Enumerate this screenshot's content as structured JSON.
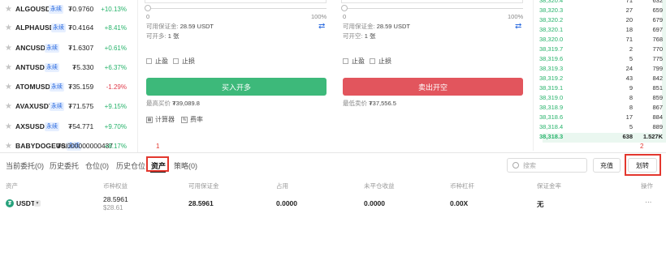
{
  "market": {
    "perp_tag": "永续",
    "rows": [
      {
        "symbol": "ALGOUSDT",
        "price": "₮0.9760",
        "change": "+10.13%",
        "dir": "up"
      },
      {
        "symbol": "ALPHAUSDT",
        "price": "₮0.4164",
        "change": "+8.41%",
        "dir": "up"
      },
      {
        "symbol": "ANCUSDT",
        "price": "₮1.6307",
        "change": "+0.61%",
        "dir": "up"
      },
      {
        "symbol": "ANTUSDT",
        "price": "₮5.330",
        "change": "+6.37%",
        "dir": "up"
      },
      {
        "symbol": "ATOMUSDT",
        "price": "₮35.159",
        "change": "-1.29%",
        "dir": "down"
      },
      {
        "symbol": "AVAXUSDT",
        "price": "₮71.575",
        "change": "+9.15%",
        "dir": "up"
      },
      {
        "symbol": "AXSUSDT",
        "price": "₮54.771",
        "change": "+9.70%",
        "dir": "up"
      },
      {
        "symbol": "BABYDOGEUSDT",
        "price": "₮0.000000000437",
        "change": "+8.17%",
        "dir": "up"
      }
    ]
  },
  "order_form": {
    "buy": {
      "slider_min": "0",
      "slider_max": "100%",
      "margin_label": "可用保证金:",
      "margin_value": "28.59 USDT",
      "open_label": "可开多:",
      "open_value": "1 张",
      "take_profit": "止盈",
      "stop_loss": "止损",
      "button": "买入开多",
      "price_label": "最高买价",
      "price_value": "₮39,089.8",
      "calculator": "计算器",
      "fee": "费率"
    },
    "sell": {
      "slider_min": "0",
      "slider_max": "100%",
      "margin_label": "可用保证金:",
      "margin_value": "28.59 USDT",
      "open_label": "可开空:",
      "open_value": "1 张",
      "take_profit": "止盈",
      "stop_loss": "止损",
      "button": "卖出开空",
      "price_label": "最低卖价",
      "price_value": "₮37,556.5"
    }
  },
  "order_book": {
    "rows": [
      {
        "price": "38,320.4",
        "qty": "71",
        "total": "632",
        "depth": 0.03
      },
      {
        "price": "38,320.3",
        "qty": "27",
        "total": "659",
        "depth": 0.03
      },
      {
        "price": "38,320.2",
        "qty": "20",
        "total": "679",
        "depth": 0.03
      },
      {
        "price": "38,320.1",
        "qty": "18",
        "total": "697",
        "depth": 0.03
      },
      {
        "price": "38,320.0",
        "qty": "71",
        "total": "768",
        "depth": 0.03
      },
      {
        "price": "38,319.7",
        "qty": "2",
        "total": "770",
        "depth": 0.03
      },
      {
        "price": "38,319.6",
        "qty": "5",
        "total": "775",
        "depth": 0.03
      },
      {
        "price": "38,319.3",
        "qty": "24",
        "total": "799",
        "depth": 0.03
      },
      {
        "price": "38,319.2",
        "qty": "43",
        "total": "842",
        "depth": 0.03
      },
      {
        "price": "38,319.1",
        "qty": "9",
        "total": "851",
        "depth": 0.03
      },
      {
        "price": "38,319.0",
        "qty": "8",
        "total": "859",
        "depth": 0.03
      },
      {
        "price": "38,318.9",
        "qty": "8",
        "total": "867",
        "depth": 0.03
      },
      {
        "price": "38,318.6",
        "qty": "17",
        "total": "884",
        "depth": 0.03
      },
      {
        "price": "38,318.4",
        "qty": "5",
        "total": "889",
        "depth": 0.03
      },
      {
        "price": "38,318.3",
        "qty": "638",
        "total": "1.527K",
        "depth": 0.95
      }
    ]
  },
  "bottom_tabs": {
    "current_orders": "当前委托(0)",
    "order_history": "历史委托",
    "positions": "仓位(0)",
    "position_history": "历史仓位",
    "assets": "资产",
    "strategy": "策略(0)",
    "annotation_1": "1",
    "annotation_2": "2",
    "search_placeholder": "搜索",
    "deposit_button": "充值",
    "transfer_button": "划转"
  },
  "assets_table": {
    "headers": {
      "asset": "资产",
      "equity": "币种权益",
      "available_margin": "可用保证金",
      "occupied": "占用",
      "unrealized_pnl": "未平仓收益",
      "leverage": "币种杠杆",
      "margin_ratio": "保证金率",
      "actions": "操作"
    },
    "row": {
      "coin_icon": "tether-icon",
      "asset": "USDT",
      "equity": "28.5961",
      "equity_usd": "$28.61",
      "available_margin": "28.5961",
      "occupied": "0.0000",
      "unrealized_pnl": "0.0000",
      "leverage": "0.00X",
      "margin_ratio": "无",
      "actions_icon": "more-dots-icon",
      "actions": "···"
    }
  },
  "colors": {
    "buy": "#3db97a",
    "sell": "#e2555d",
    "up": "#27b36b",
    "down": "#e03b4b",
    "annotation": "#e3372e",
    "tag": "#2a6adf"
  }
}
